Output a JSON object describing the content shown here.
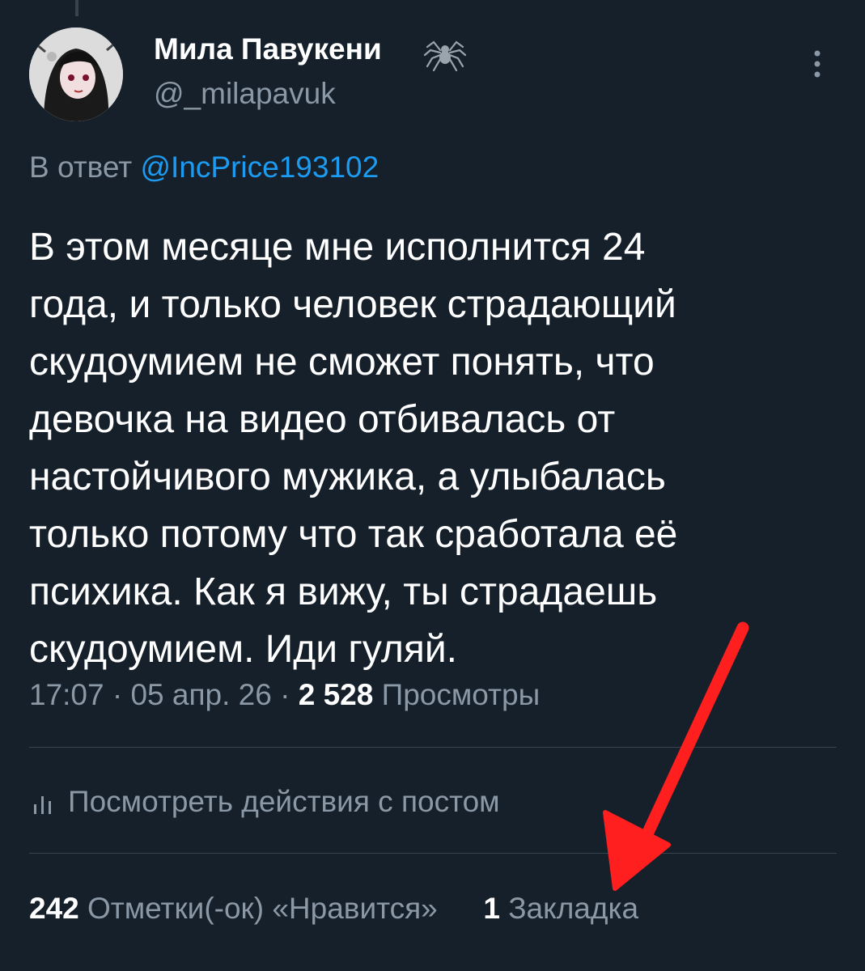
{
  "author": {
    "display_name": "Мила Павукени",
    "handle": "@_milapavuk"
  },
  "reply": {
    "prefix": "В ответ",
    "mention": "@IncPrice193102"
  },
  "tweet": {
    "lines": [
      "В этом месяце мне исполнится 24",
      "года, и только человек страдающий",
      "скудоумием не сможет понять, что",
      "девочка на видео отбивалась от",
      "настойчивого мужика, а улыбалась",
      "только потому что так сработала её",
      "психика. Как я вижу, ты страдаешь",
      "скудоумием. Иди гуляй."
    ]
  },
  "meta": {
    "time": "17:07",
    "separator": "·",
    "date": "05 апр. 26",
    "views_count": "2 528",
    "views_label": "Просмотры"
  },
  "activity": {
    "label": "Посмотреть действия с постом"
  },
  "stats": {
    "likes_count": "242",
    "likes_label": "Отметки(-ок) «Нравится»",
    "bookmarks_count": "1",
    "bookmarks_label": "Закладка"
  },
  "icons": {
    "author_emoji": "spider-icon",
    "more": "more-vertical-icon",
    "activity": "bar-chart-icon"
  },
  "colors": {
    "background": "#15202b",
    "text": "#ffffff",
    "secondary": "#8b98a5",
    "link": "#1d9bf0",
    "divider": "#38444d",
    "annotation_arrow": "#ff1f1f"
  }
}
